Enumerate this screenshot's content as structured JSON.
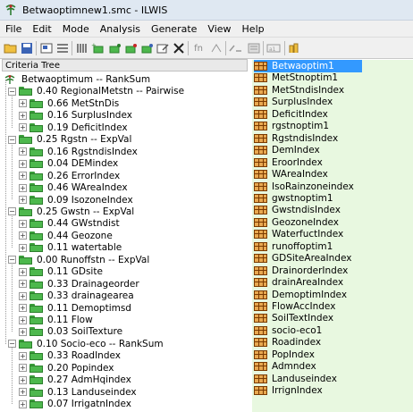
{
  "window": {
    "title": "Betwaoptimnew1.smc - ILWIS"
  },
  "menu": [
    "File",
    "Edit",
    "Mode",
    "Analysis",
    "Generate",
    "View",
    "Help"
  ],
  "toolbar": {
    "buttons": [
      "open-icon",
      "save-icon",
      "properties-icon",
      "list-icon",
      "columns-icon",
      "add-group-icon",
      "add-factor-icon",
      "add-constraint-icon",
      "add-score-icon",
      "edit-icon",
      "delete-icon",
      "function-icon",
      "standardize-icon",
      "weigh-icon",
      "map-icon",
      "values-icon",
      "show-icon"
    ],
    "fn_label": "fn"
  },
  "tree_header": "Criteria Tree",
  "tree": [
    {
      "level": 0,
      "type": "root",
      "label": "Betwaoptimum -- RankSum"
    },
    {
      "level": 1,
      "type": "group",
      "label": "0.40 RegionalMetstn -- Pairwise"
    },
    {
      "level": 2,
      "type": "factor",
      "label": "0.66 MetStnDis"
    },
    {
      "level": 2,
      "type": "factor",
      "label": "0.16 SurplusIndex"
    },
    {
      "level": 2,
      "type": "factor",
      "label": "0.19 DeficitIndex"
    },
    {
      "level": 1,
      "type": "group",
      "label": "0.25 Rgstn -- ExpVal"
    },
    {
      "level": 2,
      "type": "factor",
      "label": "0.16 RgstndisIndex"
    },
    {
      "level": 2,
      "type": "factor",
      "label": "0.04 DEMindex"
    },
    {
      "level": 2,
      "type": "factor",
      "label": "0.26 ErrorIndex"
    },
    {
      "level": 2,
      "type": "factor",
      "label": "0.46 WAreaIndex"
    },
    {
      "level": 2,
      "type": "factor",
      "label": "0.09 IsozoneIndex"
    },
    {
      "level": 1,
      "type": "group",
      "label": "0.25 Gwstn -- ExpVal"
    },
    {
      "level": 2,
      "type": "factor",
      "label": "0.44 GWstndist"
    },
    {
      "level": 2,
      "type": "factor",
      "label": "0.44 Geozone"
    },
    {
      "level": 2,
      "type": "factor",
      "label": "0.11 watertable"
    },
    {
      "level": 1,
      "type": "group",
      "label": "0.00 Runoffstn -- ExpVal"
    },
    {
      "level": 2,
      "type": "factor",
      "label": "0.11 GDsite"
    },
    {
      "level": 2,
      "type": "factor",
      "label": "0.33 Drainageorder"
    },
    {
      "level": 2,
      "type": "factor",
      "label": "0.33 drainagearea"
    },
    {
      "level": 2,
      "type": "factor",
      "label": "0.11 Demoptimsd"
    },
    {
      "level": 2,
      "type": "factor",
      "label": "0.11 Flow"
    },
    {
      "level": 2,
      "type": "factor",
      "label": "0.03 SoilTexture"
    },
    {
      "level": 1,
      "type": "group",
      "label": "0.10 Socio-eco -- RankSum"
    },
    {
      "level": 2,
      "type": "factor",
      "label": "0.33 RoadIndex"
    },
    {
      "level": 2,
      "type": "factor",
      "label": "0.20 Popindex"
    },
    {
      "level": 2,
      "type": "factor",
      "label": "0.27 AdmHqindex"
    },
    {
      "level": 2,
      "type": "factor",
      "label": "0.13 Landuseindex"
    },
    {
      "level": 2,
      "type": "factor",
      "label": "0.07 IrrigatnIndex"
    }
  ],
  "maps": [
    "Betwaoptim1",
    "MetStnoptim1",
    "MetStndisIndex",
    "SurplusIndex",
    "DeficitIndex",
    "rgstnoptim1",
    "RgstndisIndex",
    "DemIndex",
    "EroorIndex",
    "WAreaIndex",
    "IsoRainzoneindex",
    "gwstnoptim1",
    "GwstndisIndex",
    "GeozoneIndex",
    "WaterfuctIndex",
    "runoffoptim1",
    "GDSiteAreaIndex",
    "DrainorderIndex",
    "drainAreaIndex",
    "DemoptimIndex",
    "FlowAccIndex",
    "SoilTextIndex",
    "socio-eco1",
    "Roadindex",
    "PopIndex",
    "Admndex",
    "Landuseindex",
    "IrrignIndex"
  ],
  "selected_map": 0,
  "colors": {
    "selection": "#3399ff",
    "map_pane_bg": "#e8f8e0",
    "folder": "#4db84d"
  }
}
